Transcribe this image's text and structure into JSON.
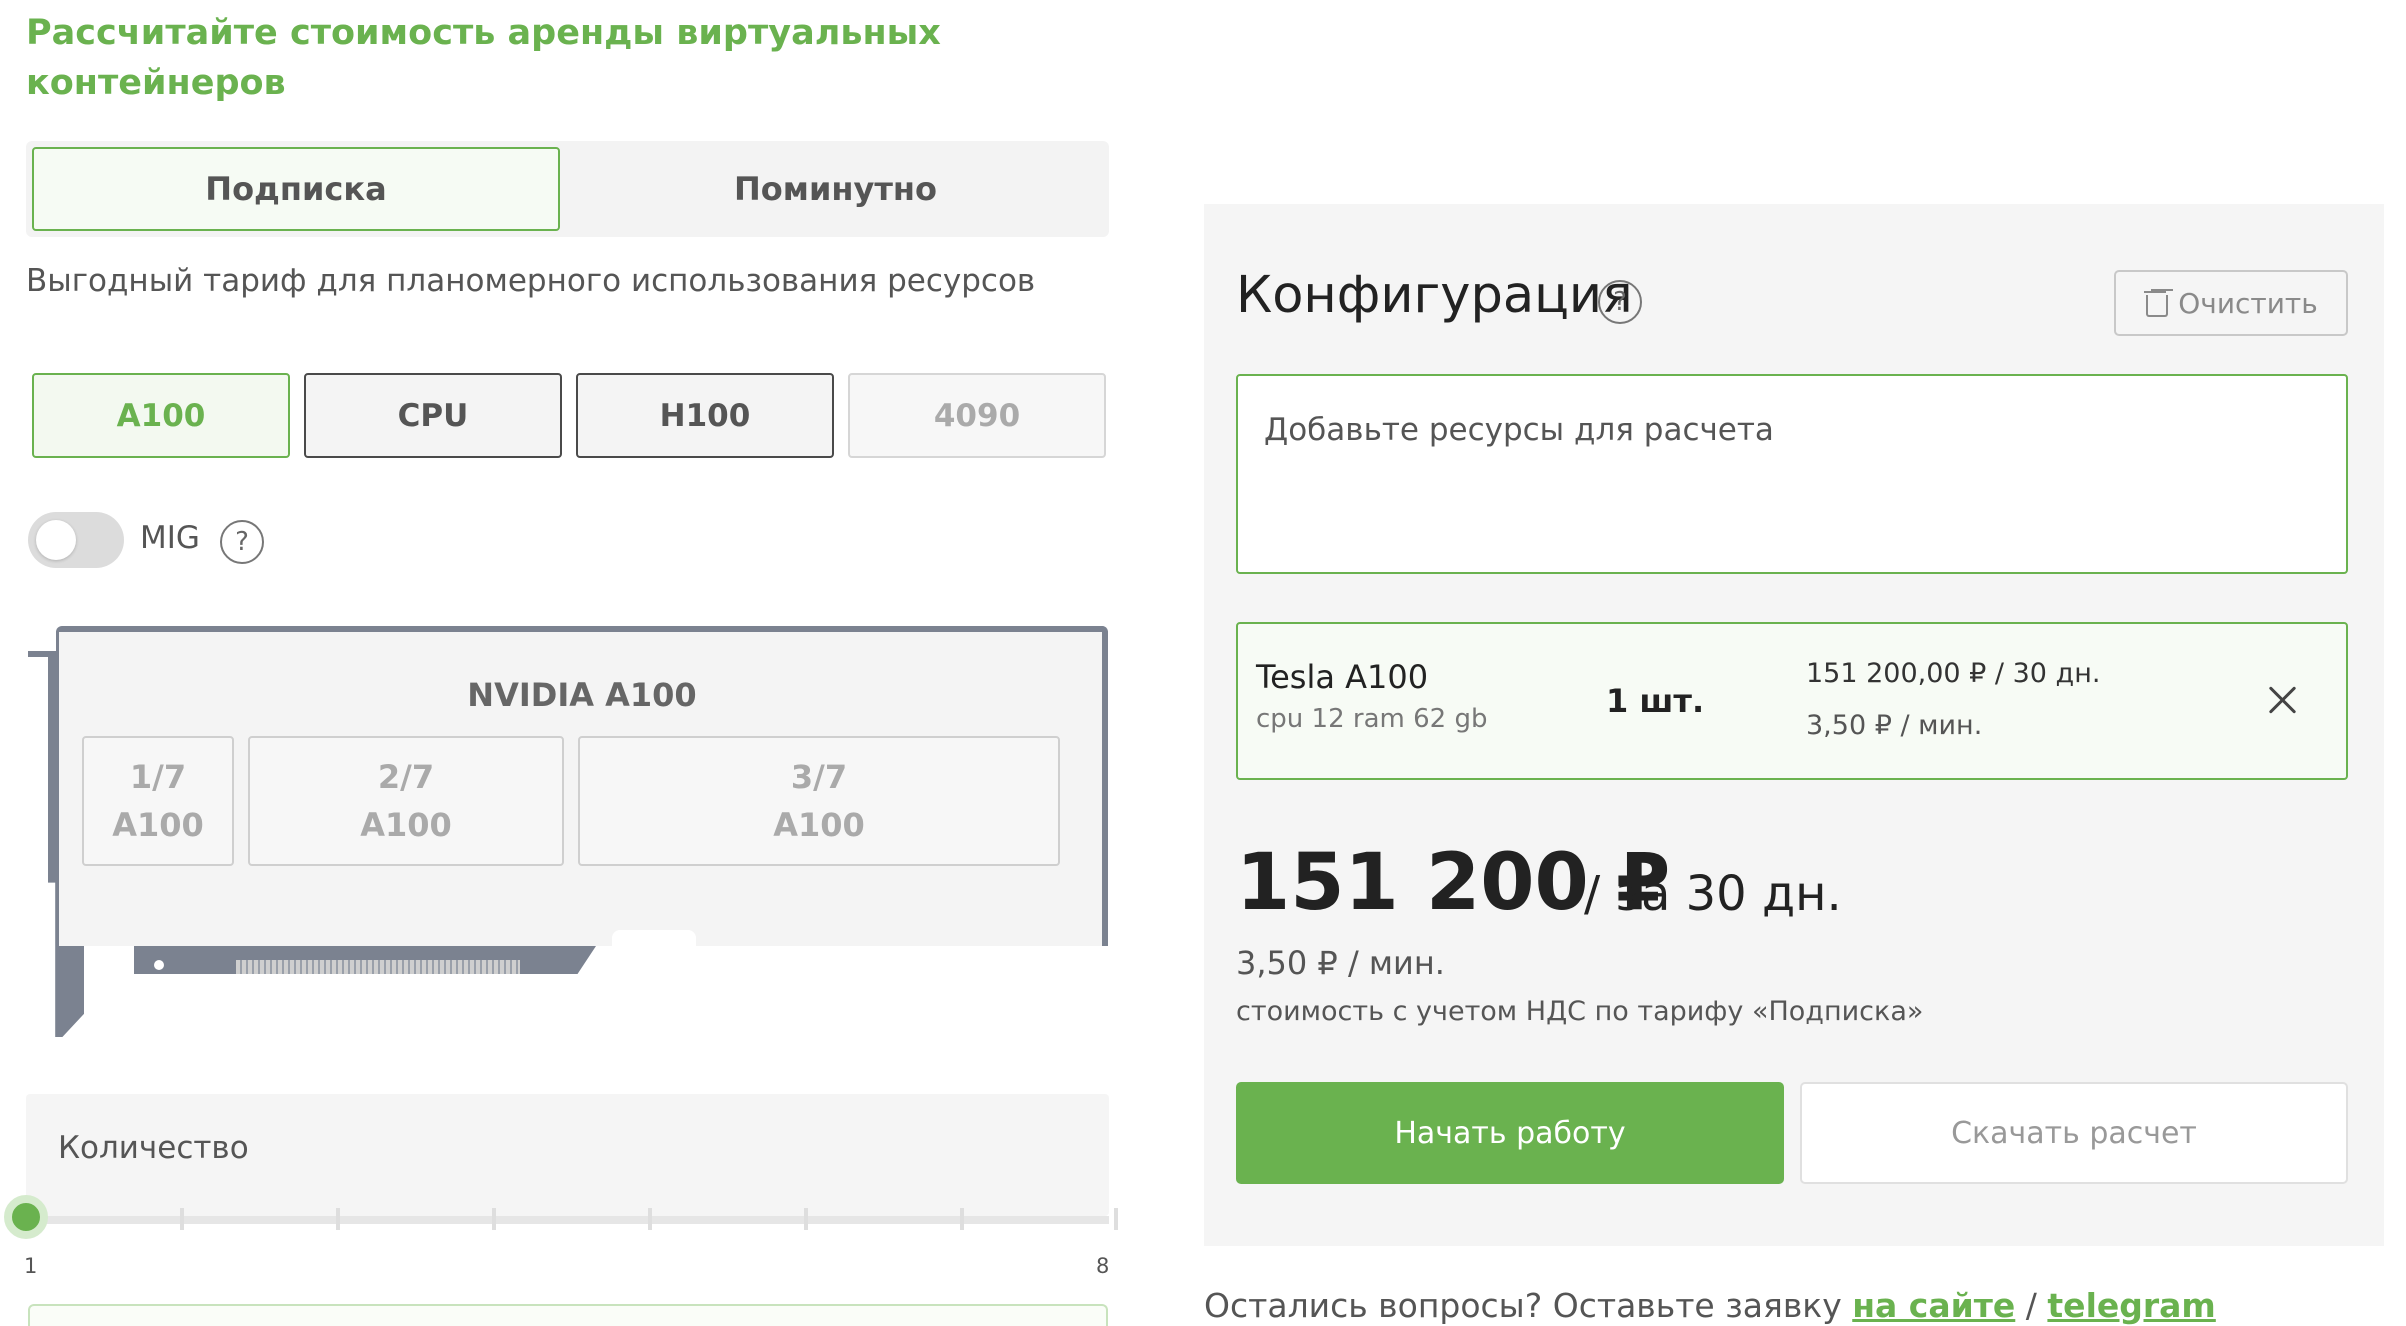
{
  "page": {
    "title": "Рассчитайте стоимость аренды виртуальных контейнеров"
  },
  "mode_switch": {
    "subscription_label": "Подписка",
    "per_minute_label": "Поминутно"
  },
  "subtitle": "Выгодный тариф для планомерного использования ресурсов",
  "gpu_types": [
    {
      "label": "A100",
      "state": "active"
    },
    {
      "label": "CPU",
      "state": "normal"
    },
    {
      "label": "H100",
      "state": "normal"
    },
    {
      "label": "4090",
      "state": "disabled"
    }
  ],
  "mig": {
    "label": "MIG",
    "help": "?",
    "enabled": false
  },
  "gpu_card": {
    "label": "NVIDIA A100",
    "slots": [
      {
        "fraction": "1/7",
        "model": "A100"
      },
      {
        "fraction": "2/7",
        "model": "A100"
      },
      {
        "fraction": "3/7",
        "model": "A100"
      }
    ]
  },
  "quantity": {
    "label": "Количество",
    "min": "1",
    "max": "8",
    "value": 1
  },
  "config": {
    "title": "Конфигурация",
    "help": "?",
    "clear_label": "Очистить",
    "placeholder": "Добавьте ресурсы для расчета",
    "item": {
      "name": "Tesla A100",
      "specs": "cpu 12 ram 62 gb",
      "quantity": "1 шт.",
      "price_month": "151 200,00 ₽ / 30 дн.",
      "price_min": "3,50 ₽ / мин."
    },
    "total": {
      "amount": "151 200 ₽",
      "period": "/ за 30 дн.",
      "per_min": "3,50 ₽ / мин.",
      "note": "стоимость с учетом НДС по тарифу «Подписка»"
    },
    "start_label": "Начать работу",
    "download_label": "Скачать расчет"
  },
  "footer": {
    "text": "Остались вопросы? Оставьте заявку",
    "link_site": "на сайте",
    "separator": "/",
    "link_telegram": "telegram"
  },
  "colors": {
    "accent": "#6ab24f",
    "panel": "#f5f5f5"
  }
}
